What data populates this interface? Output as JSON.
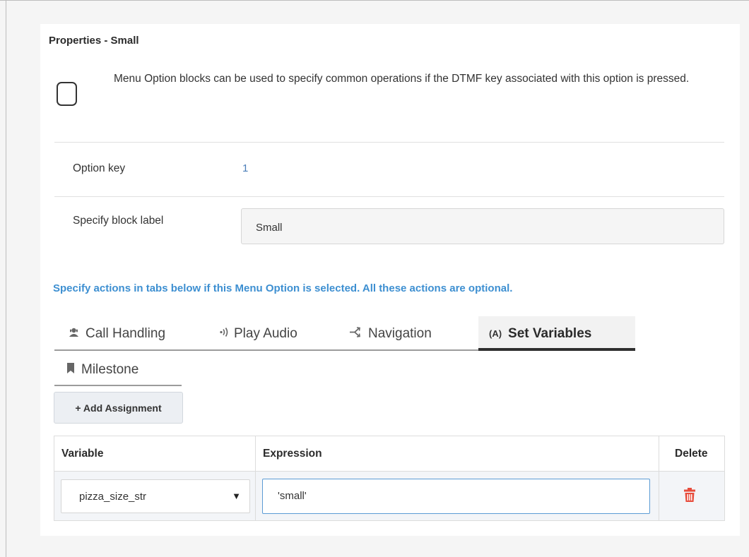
{
  "panel": {
    "title": "Properties - Small",
    "description": "Menu Option blocks can be used to specify common operations if the DTMF key associated with this option is pressed."
  },
  "fields": {
    "option_key_label": "Option key",
    "option_key_value": "1",
    "block_label_label": "Specify block label",
    "block_label_value": "Small"
  },
  "hint": "Specify actions in tabs below if this Menu Option is selected. All these actions are optional.",
  "tabs": [
    {
      "label": "Call Handling",
      "icon": "call-handling-icon"
    },
    {
      "label": "Play Audio",
      "icon": "audio-icon"
    },
    {
      "label": "Navigation",
      "icon": "navigation-icon"
    },
    {
      "label": "Set Variables",
      "icon": "variables-icon",
      "icon_text": "(A)",
      "active": true
    },
    {
      "label": "Milestone",
      "icon": "bookmark-icon"
    }
  ],
  "add_button": "+ Add Assignment",
  "table": {
    "headers": {
      "variable": "Variable",
      "expression": "Expression",
      "delete": "Delete"
    },
    "rows": [
      {
        "variable": "pizza_size_str",
        "expression": "'small'"
      }
    ]
  },
  "colors": {
    "accent": "#3d8fd1",
    "value_blue": "#4a7db8",
    "delete_red": "#e74c3c",
    "focus_border": "#5b9bd5"
  }
}
